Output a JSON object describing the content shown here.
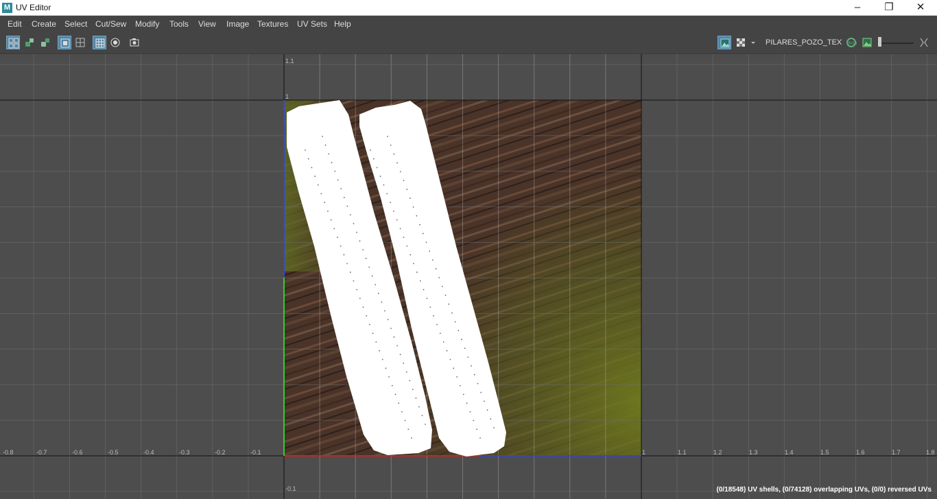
{
  "window": {
    "title": "UV Editor",
    "app_icon": "M",
    "controls": [
      "minimize-icon",
      "maximize-icon",
      "close-icon"
    ]
  },
  "menu": [
    "Edit",
    "Create",
    "Select",
    "Cut/Sew",
    "Modify",
    "Tools",
    "View",
    "Image",
    "Textures",
    "UV Sets",
    "Help"
  ],
  "toolbar": {
    "texture_name": "PILARES_POZO_TEXTU",
    "icons": [
      "uv-shell-icon",
      "uv-isolate-icon",
      "uv-unisolate-icon",
      "shaded-uv-icon",
      "wireframe-uv-icon",
      "grid-icon",
      "pixel-snap-icon",
      "snapshot-icon",
      "image-display-icon",
      "checker-icon",
      "dropdown-icon",
      "texture-filter-icon",
      "channel-rgb-icon",
      "exposure-icon",
      "slider-icon",
      "frame-icon"
    ],
    "exposure_level": 0.05
  },
  "viewport": {
    "u_labels": [
      "-0.8",
      "-0.7",
      "-0.6",
      "-0.5",
      "-0.4",
      "-0.3",
      "-0.2",
      "-0.1",
      "1",
      "1.1",
      "1.2",
      "1.3",
      "1.4",
      "1.5",
      "1.6",
      "1.7",
      "1.8"
    ],
    "v_labels": [
      "1.1",
      "1",
      "-0.1"
    ],
    "colors": {
      "background": "#4d4d4d",
      "texture_dark": "#4a3328",
      "texture_green": "#5a6320",
      "uv_shells": "#ffffff",
      "u_axis": "#cc2222",
      "v_axis": "#33cc33"
    }
  },
  "status": "(0/18548) UV shells, (0/74128) overlapping UVs, (0/0) reversed UVs"
}
